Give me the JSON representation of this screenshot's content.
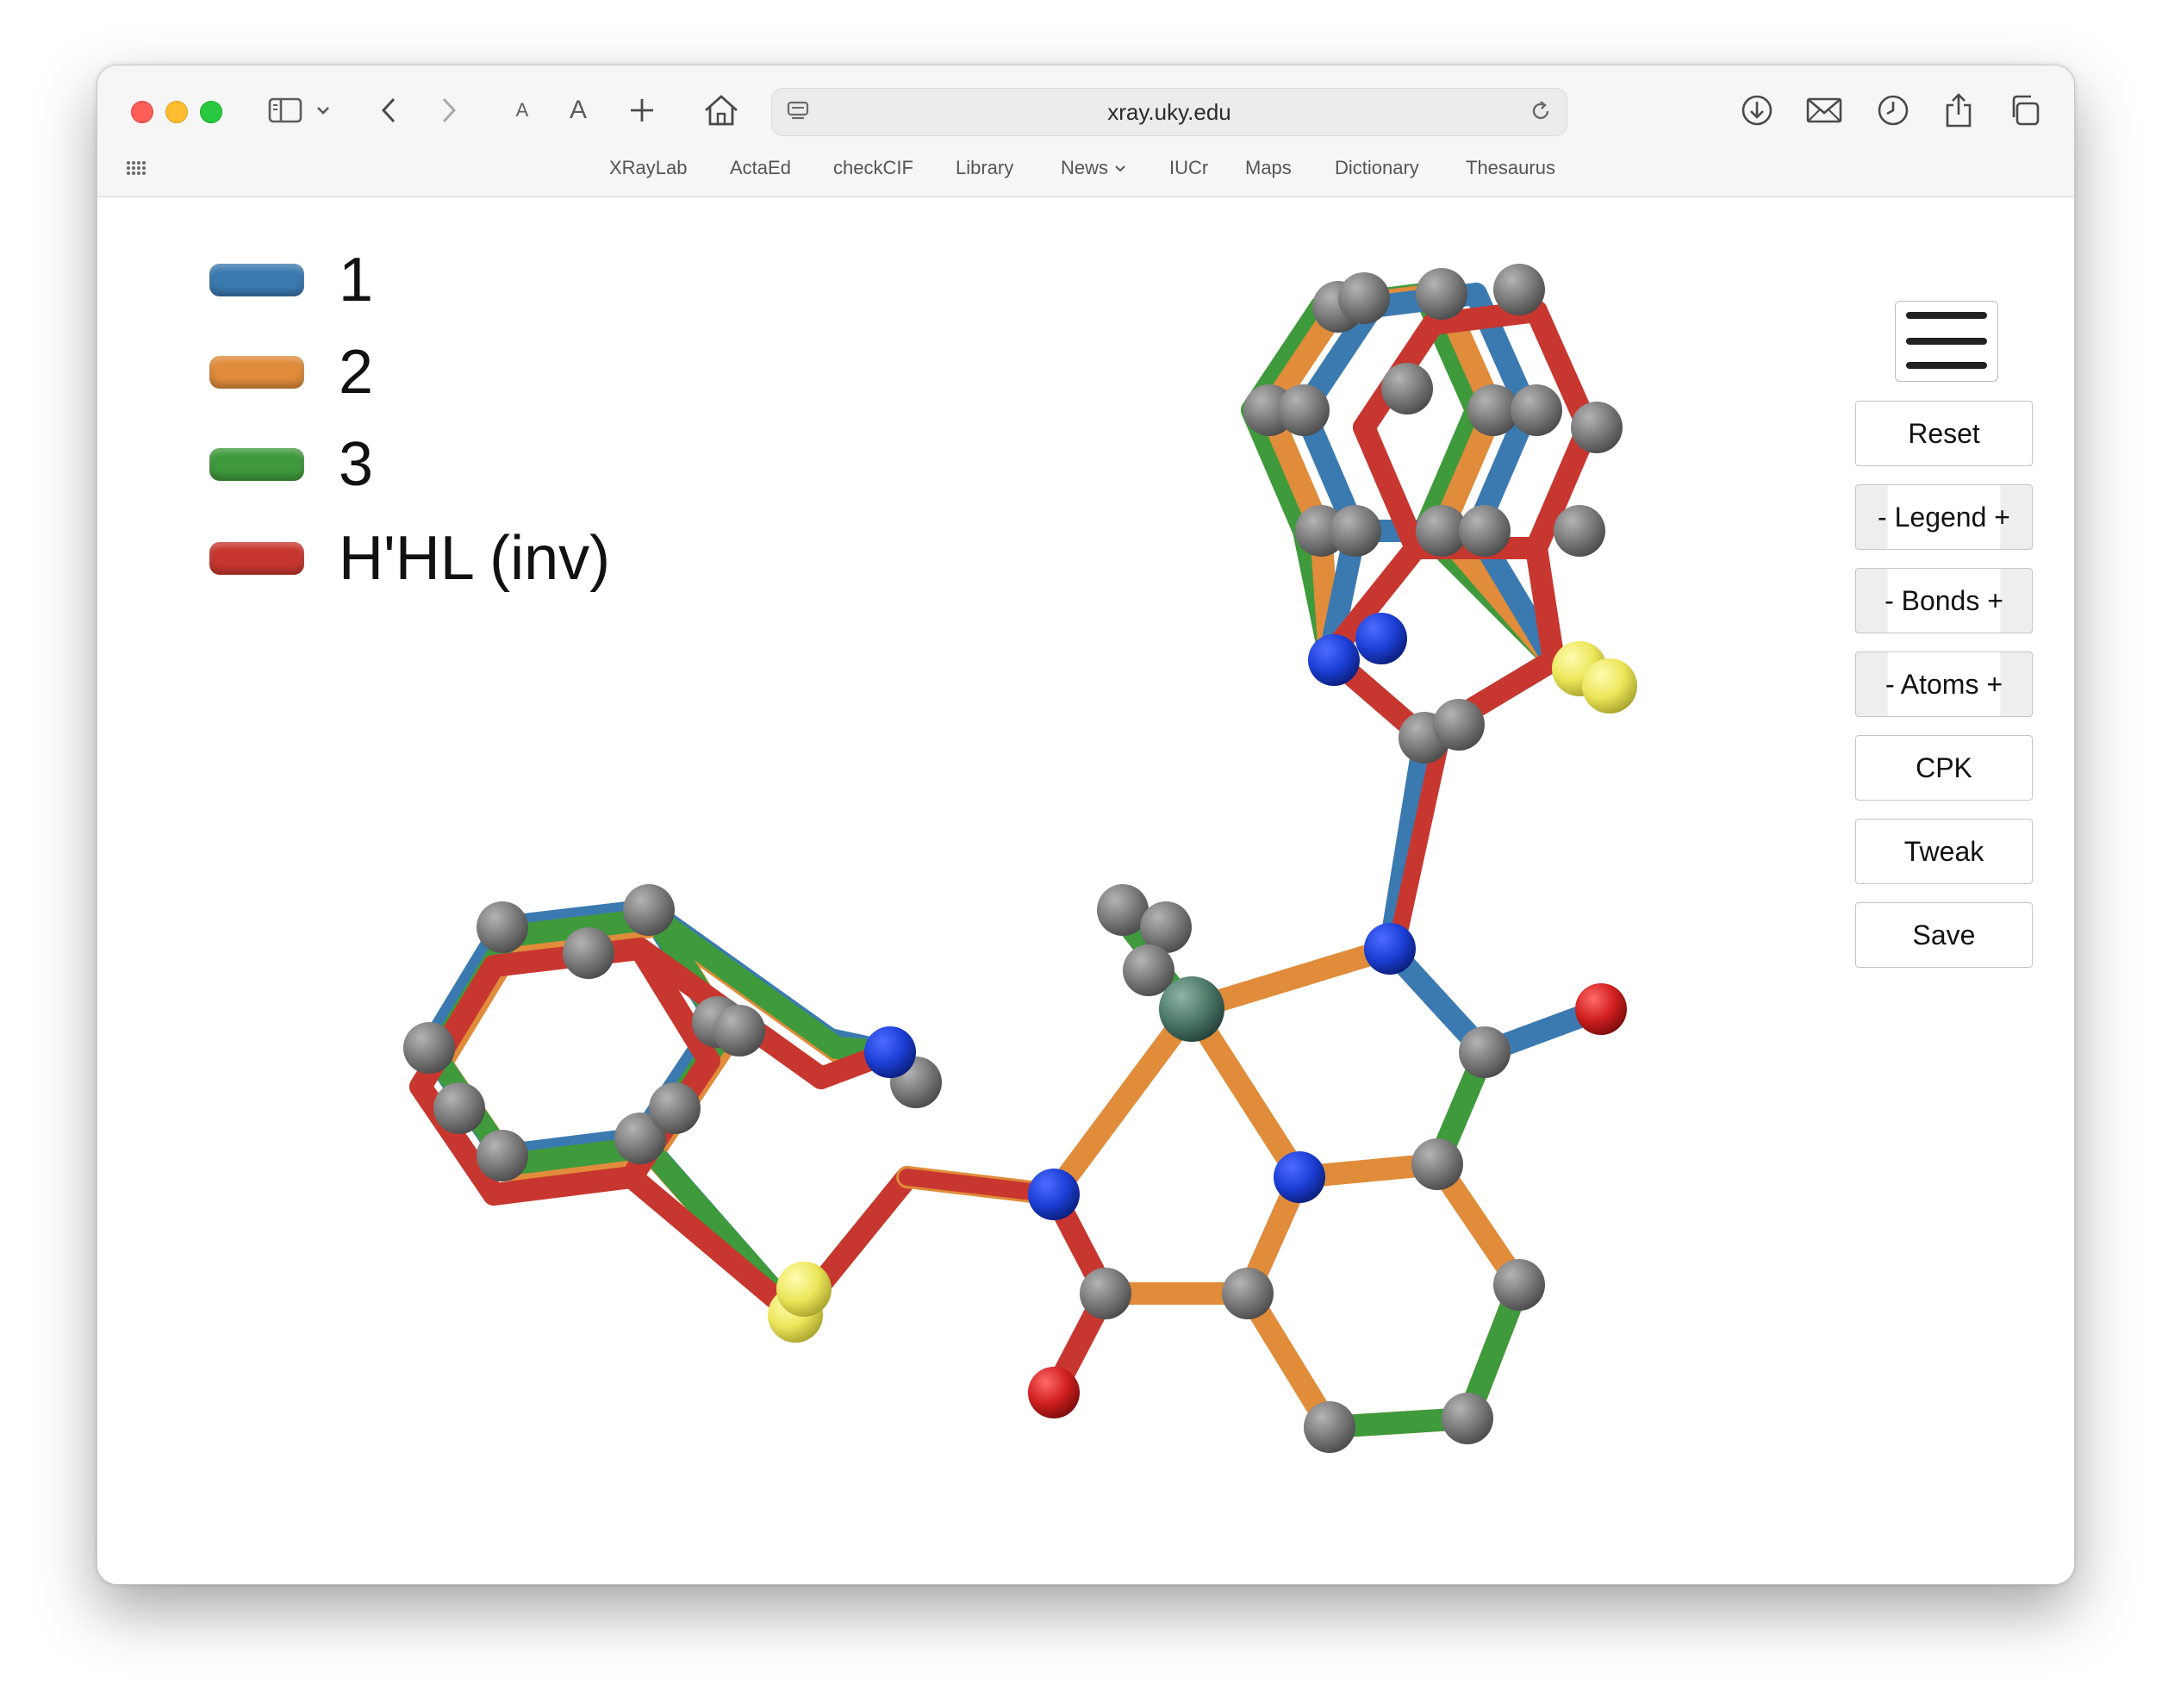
{
  "browser": {
    "url": "xray.uky.edu",
    "text_small": "A",
    "text_large": "A",
    "favorites": [
      "XRayLab",
      "ActaEd",
      "checkCIF",
      "Library",
      "News",
      "IUCr",
      "Maps",
      "Dictionary",
      "Thesaurus"
    ]
  },
  "legend": {
    "items": [
      {
        "label": "1",
        "color": "#3b7ab0"
      },
      {
        "label": "2",
        "color": "#e08c3a"
      },
      {
        "label": "3",
        "color": "#3f9a3c"
      },
      {
        "label": "H'HL (inv)",
        "color": "#c8372f"
      }
    ]
  },
  "controls": {
    "reset": "Reset",
    "legend": "- Legend +",
    "bonds": "- Bonds +",
    "atoms": "- Atoms +",
    "cpk": "CPK",
    "tweak": "Tweak",
    "save": "Save"
  },
  "colors": {
    "carbon": "#7a7a7a",
    "nitrogen": "#1c3fd6",
    "sulfur": "#ece65a",
    "oxygen": "#d11f1f",
    "metal": "#4d7a6a",
    "bond_blue": "#3b7ab0",
    "bond_orange": "#e08c3a",
    "bond_green": "#3f9a3c",
    "bond_red": "#c8372f"
  }
}
